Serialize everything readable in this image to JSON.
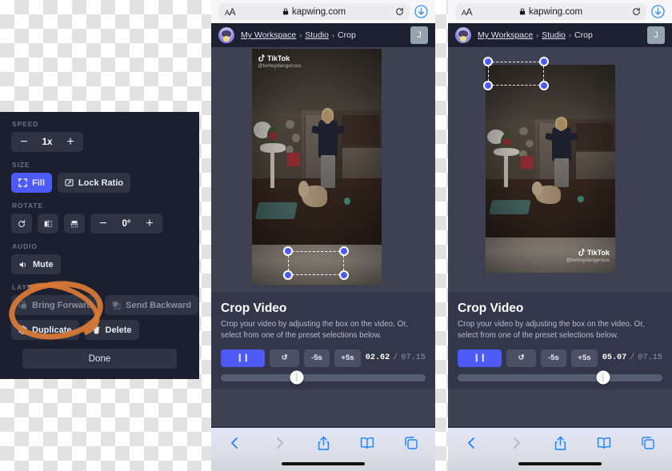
{
  "editor_panel": {
    "sections": [
      {
        "label": "SPEED",
        "type": "stepper",
        "minus": "−",
        "value": "1x",
        "plus": "+"
      },
      {
        "label": "SIZE",
        "type": "buttons",
        "buttons": [
          {
            "label": "Fill",
            "icon": "expand-icon",
            "accent": true
          },
          {
            "label": "Lock Ratio",
            "icon": "aspect-ratio-icon",
            "accent": false
          }
        ]
      },
      {
        "label": "ROTATE",
        "type": "rotate",
        "icons": [
          "rotate-cw-icon",
          "flip-horizontal-icon",
          "flip-vertical-icon"
        ],
        "minus": "−",
        "value": "0°",
        "plus": "+"
      },
      {
        "label": "AUDIO",
        "type": "buttons",
        "buttons": [
          {
            "label": "Mute",
            "icon": "speaker-icon",
            "accent": false
          }
        ]
      },
      {
        "label": "LAYER",
        "type": "layer",
        "buttons": [
          {
            "label": "Bring Forward",
            "icon": "bring-forward-icon",
            "disabled": true
          },
          {
            "label": "Send Backward",
            "icon": "send-backward-icon",
            "disabled": true
          },
          {
            "label": "Duplicate",
            "icon": "duplicate-icon",
            "disabled": false
          },
          {
            "label": "Delete",
            "icon": "trash-icon",
            "disabled": false
          }
        ]
      }
    ],
    "done_label": "Done",
    "annotation": {
      "shape": "hand-drawn-circle",
      "color": "#d97a36",
      "targets": "Duplicate"
    },
    "colors": {
      "panel_bg": "#1c1f2e",
      "button_bg": "#2f3445",
      "accent": "#4d5af5",
      "label": "#6d7285"
    }
  },
  "panels": [
    {
      "id": "mid",
      "browser": {
        "aa_label": "AA",
        "lock_icon": "lock-icon",
        "url": "kapwing.com",
        "reload_icon": "reload-icon",
        "download_icon": "download-icon"
      },
      "app_header": {
        "avatar": "workspace-avatar",
        "breadcrumb": [
          {
            "label": "My Workspace",
            "link": true
          },
          {
            "label": "Studio",
            "link": true
          },
          {
            "label": "Crop",
            "link": false
          }
        ],
        "separator": "›",
        "account_initial": "J"
      },
      "video": {
        "watermark_position": "top-left",
        "watermark_brand": "TikTok",
        "watermark_handle": "@keheydangerous",
        "crop_selection_position": "bottom-right"
      },
      "crop_panel": {
        "title": "Crop Video",
        "description": "Crop your video by adjusting the box on the video. Or, select from one of the preset selections below.",
        "controls": {
          "play_pause": "❙❙",
          "reset": "↺",
          "back_5": "-5s",
          "fwd_5": "+5s"
        },
        "time_current": "02.62",
        "time_separator": "/",
        "time_total": "07.15",
        "progress_percent": 37
      },
      "toolbar": {
        "back_icon": "chevron-left-icon",
        "forward_icon": "chevron-right-icon",
        "share_icon": "share-icon",
        "bookmarks_icon": "book-icon",
        "tabs_icon": "tabs-icon"
      }
    },
    {
      "id": "right",
      "browser": {
        "aa_label": "AA",
        "lock_icon": "lock-icon",
        "url": "kapwing.com",
        "reload_icon": "reload-icon",
        "download_icon": "download-icon"
      },
      "app_header": {
        "avatar": "workspace-avatar",
        "breadcrumb": [
          {
            "label": "My Workspace",
            "link": true
          },
          {
            "label": "Studio",
            "link": true
          },
          {
            "label": "Crop",
            "link": false
          }
        ],
        "separator": "›",
        "account_initial": "J"
      },
      "video": {
        "watermark_position": "bottom-right",
        "watermark_brand": "TikTok",
        "watermark_handle": "@keheydangerous",
        "crop_selection_position": "top-left"
      },
      "crop_panel": {
        "title": "Crop Video",
        "description": "Crop your video by adjusting the box on the video. Or, select from one of the preset selections below.",
        "controls": {
          "play_pause": "❙❙",
          "reset": "↺",
          "back_5": "-5s",
          "fwd_5": "+5s"
        },
        "time_current": "05.07",
        "time_separator": "/",
        "time_total": "07.15",
        "progress_percent": 71
      },
      "toolbar": {
        "back_icon": "chevron-left-icon",
        "forward_icon": "chevron-right-icon",
        "share_icon": "share-icon",
        "bookmarks_icon": "book-icon",
        "tabs_icon": "tabs-icon"
      }
    }
  ]
}
